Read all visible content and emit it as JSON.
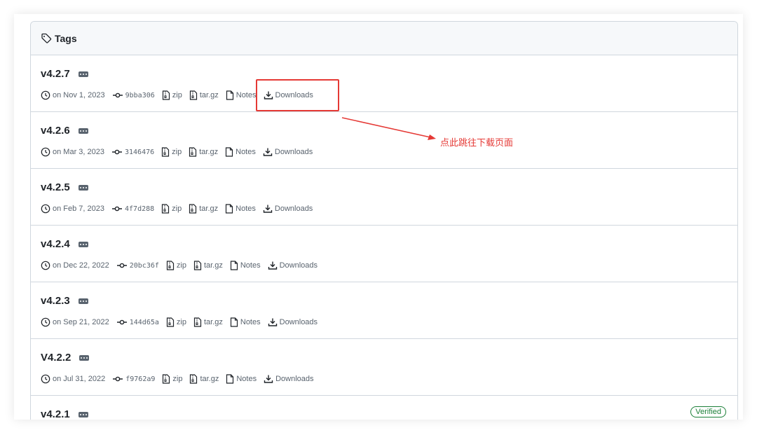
{
  "header": {
    "title": "Tags",
    "icon": "tag-icon"
  },
  "tags": [
    {
      "name": "v4.2.7",
      "date": "on Nov 1, 2023",
      "sha": "9bba306",
      "zip": "zip",
      "targz": "tar.gz",
      "notes": "Notes",
      "downloads": "Downloads"
    },
    {
      "name": "v4.2.6",
      "date": "on Mar 3, 2023",
      "sha": "3146476",
      "zip": "zip",
      "targz": "tar.gz",
      "notes": "Notes",
      "downloads": "Downloads"
    },
    {
      "name": "v4.2.5",
      "date": "on Feb 7, 2023",
      "sha": "4f7d288",
      "zip": "zip",
      "targz": "tar.gz",
      "notes": "Notes",
      "downloads": "Downloads"
    },
    {
      "name": "v4.2.4",
      "date": "on Dec 22, 2022",
      "sha": "20bc36f",
      "zip": "zip",
      "targz": "tar.gz",
      "notes": "Notes",
      "downloads": "Downloads"
    },
    {
      "name": "v4.2.3",
      "date": "on Sep 21, 2022",
      "sha": "144d65a",
      "zip": "zip",
      "targz": "tar.gz",
      "notes": "Notes",
      "downloads": "Downloads"
    },
    {
      "name": "V4.2.2",
      "date": "on Jul 31, 2022",
      "sha": "f9762a9",
      "zip": "zip",
      "targz": "tar.gz",
      "notes": "Notes",
      "downloads": "Downloads"
    },
    {
      "name": "v4.2.1",
      "verified": "Verified"
    }
  ],
  "annotation": {
    "text": "点此跳往下载页面",
    "color": "#e53935"
  },
  "colors": {
    "border": "#d0d7de",
    "header_bg": "#f6f8fa",
    "muted": "#59636e",
    "verified": "#1a7f37"
  }
}
